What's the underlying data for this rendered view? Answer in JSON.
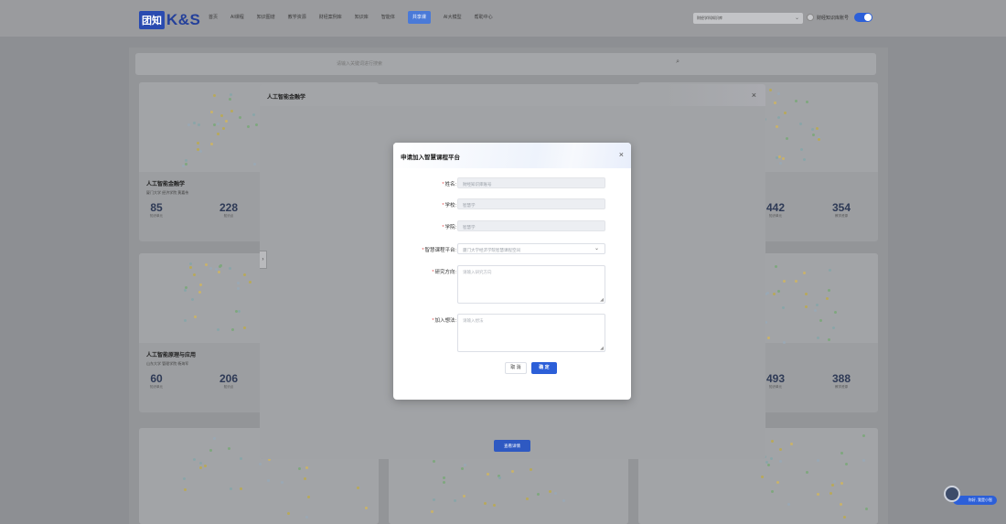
{
  "nav": {
    "logo_box": "团知",
    "logo_text": "K&S",
    "items": [
      {
        "label": "首页",
        "active": false
      },
      {
        "label": "AI课程",
        "active": false
      },
      {
        "label": "知识图谱",
        "active": false
      },
      {
        "label": "教学资源",
        "active": false
      },
      {
        "label": "财经案例库",
        "active": false
      },
      {
        "label": "知识库",
        "active": false
      },
      {
        "label": "智能体",
        "active": false
      },
      {
        "label": "共享课",
        "active": true
      },
      {
        "label": "AI大模型",
        "active": false
      },
      {
        "label": "帮助中心",
        "active": false
      }
    ],
    "org_select": "财经学科知识库",
    "user_name": "财经知识库账号"
  },
  "search": {
    "placeholder": "请输入关键词进行搜索"
  },
  "cards": [
    {
      "title": "人工智能金融学",
      "sub": "厦门大学 经济学院 黄嘉伟",
      "stat1": "85",
      "stat1_label": "知识单元",
      "stat2": "228",
      "stat2_label": "知识点"
    },
    {
      "title": "人工智能原理与应用",
      "sub": "山东大学 管理学院 杨海军",
      "stat1": "60",
      "stat1_label": "知识单元",
      "stat2": "206",
      "stat2_label": "知识点"
    },
    {
      "stat1": "442",
      "stat1_label": "知识单元",
      "stat2": "354",
      "stat2_label": "教学资源"
    },
    {
      "stat1": "493",
      "stat1_label": "知识单元",
      "stat2": "388",
      "stat2_label": "教学资源"
    }
  ],
  "outer_modal": {
    "title": "人工智能金融学",
    "detail_button": "查看详情"
  },
  "dialog": {
    "title": "申请加入智慧课程平台",
    "fields": {
      "name_label": "姓名:",
      "name_value": "财经知识库账号",
      "school_label": "学校:",
      "school_value": "智慧学",
      "college_label": "学院:",
      "college_value": "智慧学",
      "platform_label": "智慧课程平台:",
      "platform_value": "厦门大学经济学院智慧课程空间",
      "research_label": "研究方向:",
      "research_placeholder": "请输入研究方向",
      "idea_label": "加入想法:",
      "idea_placeholder": "请输入想法"
    },
    "cancel_label": "取 消",
    "ok_label": "确 定"
  },
  "bot": {
    "label": "你好, 我是小智"
  },
  "colors": {
    "accent": "#2c5fd8",
    "required": "#e04646"
  }
}
